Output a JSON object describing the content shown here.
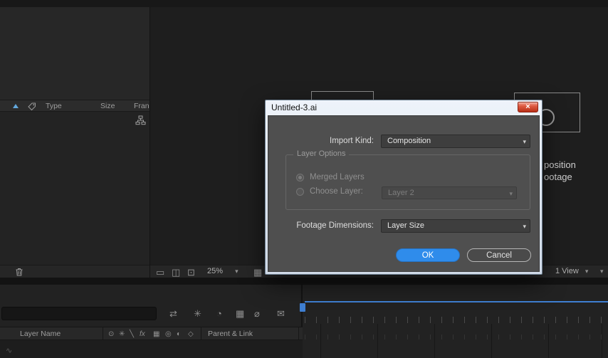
{
  "ui": {
    "chevron": "▾",
    "close_icon": "×"
  },
  "dialog": {
    "title": "Untitled-3.ai",
    "import_kind_label": "Import Kind:",
    "import_kind_value": "Composition",
    "layer_options_label": "Layer Options",
    "merged_layers_label": "Merged Layers",
    "choose_layer_label": "Choose Layer:",
    "choose_layer_value": "Layer 2",
    "footage_dimensions_label": "Footage Dimensions:",
    "footage_dimensions_value": "Layer Size",
    "ok_label": "OK",
    "cancel_label": "Cancel"
  },
  "project_panel": {
    "columns": [
      "Type",
      "Size",
      "Fran"
    ]
  },
  "comp_panel": {
    "zoom_value": "25%",
    "view_value": "1 View",
    "obscured_composition_text": "position",
    "obscured_footage_text": "ootage",
    "toolbar_icons": [
      "▭",
      "◫",
      "⊡"
    ],
    "grid_icon": "▦"
  },
  "timeline": {
    "layer_name_label": "Layer Name",
    "parent_link_label": "Parent & Link",
    "toolbar_icons": [
      "⇄",
      "✳",
      "◔",
      "▦",
      "⌀",
      "✉"
    ],
    "header_icons": [
      "⊙",
      "✳",
      "╲",
      "fx",
      "▦",
      "◎",
      "◐",
      "◇"
    ]
  }
}
